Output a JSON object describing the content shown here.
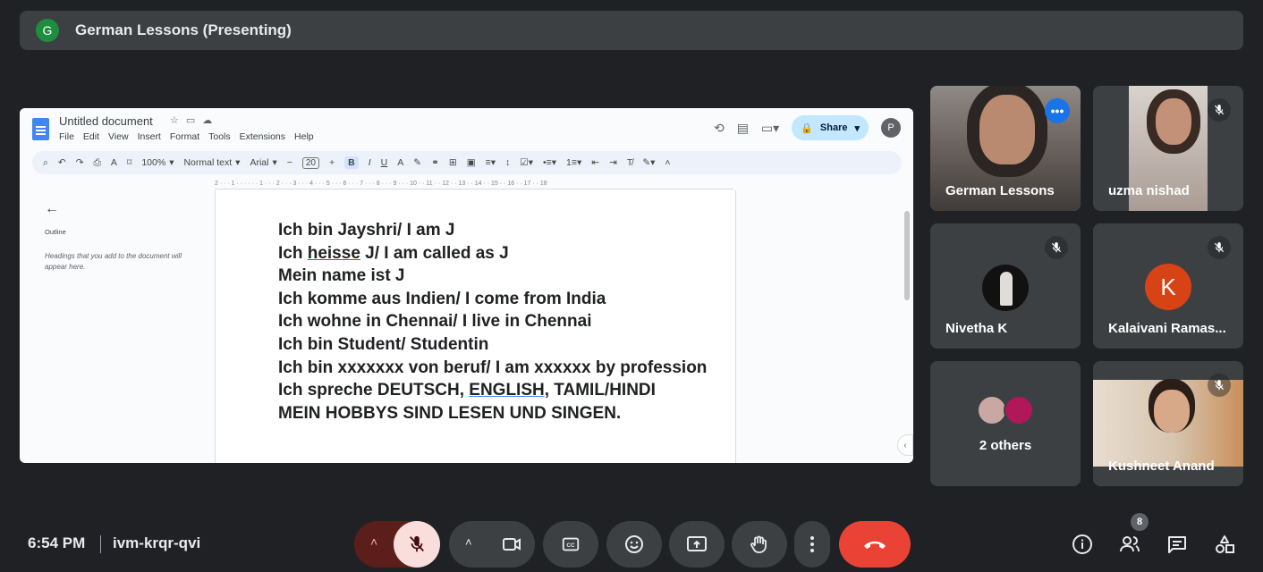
{
  "topbar": {
    "avatar_letter": "G",
    "title": "German Lessons (Presenting)"
  },
  "doc": {
    "name": "Untitled document",
    "menu": [
      "File",
      "Edit",
      "View",
      "Insert",
      "Format",
      "Tools",
      "Extensions",
      "Help"
    ],
    "share_label": "Share",
    "account_letter": "P",
    "toolbar": {
      "zoom": "100%",
      "style": "Normal text",
      "font": "Arial",
      "font_size": "20"
    },
    "outline_title": "Outline",
    "outline_hint": "Headings that you add to the document will appear here.",
    "ruler": "2 · · · 1 · · · · · · 1 · · · 2 · · · 3 · · · 4 · · · 5 · · · 6 · · · 7 · · · 8 · · · 9 · · · 10 · · 11 · · 12 · · 13 · · 14 · · 15 · · 16 · · 17 · · 18",
    "lines": [
      "Ich bin Jayshri/ I am J",
      "Ich ",
      "heisse",
      " J/ I am called as J",
      "Mein name ist J",
      "Ich komme aus Indien/ I come from India",
      "Ich wohne in Chennai/ I live in Chennai",
      "Ich bin Student/ Studentin",
      "Ich bin xxxxxxx von beruf/ I am xxxxxx by profession",
      "Ich spreche DEUTSCH, ",
      "ENGLISH",
      ", TAMIL/HINDI",
      "MEIN HOBBYS SIND LESEN UND SINGEN."
    ]
  },
  "participants": [
    {
      "name": "German Lessons"
    },
    {
      "name": "uzma nishad"
    },
    {
      "name": "Nivetha K"
    },
    {
      "name": "Kalaivani Ramas...",
      "initial": "K"
    },
    {
      "name": "2 others"
    },
    {
      "name": "Kushneet Anand"
    }
  ],
  "bottombar": {
    "time": "6:54 PM",
    "meeting_code": "ivm-krqr-qvi",
    "people_count": "8"
  },
  "colors": {
    "end_call": "#ea4335",
    "mic_off_bg": "#f9dedc",
    "active_speaker": "#8ab4f8"
  }
}
